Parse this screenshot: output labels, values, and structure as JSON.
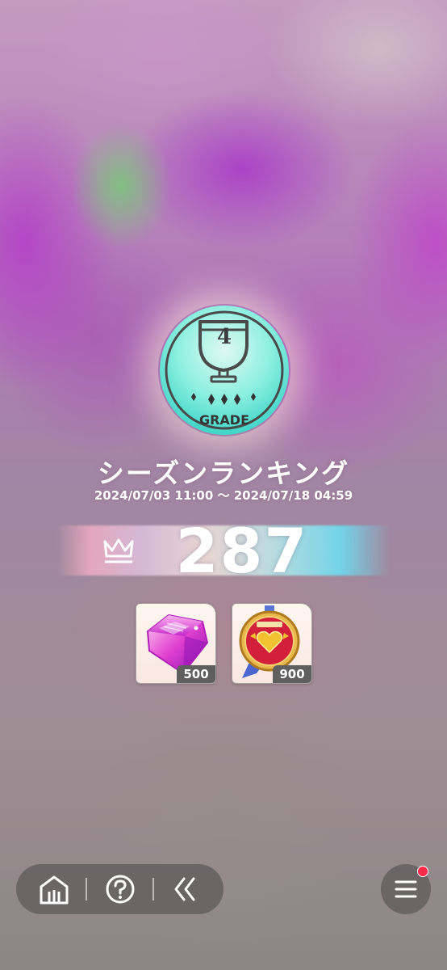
{
  "grade": {
    "number": "4",
    "label": "GRADE"
  },
  "season": {
    "title": "シーズンランキング",
    "period": "2024/07/03 11:00 ～ 2024/07/18 04:59"
  },
  "rank": {
    "value": "287",
    "icon": "crown-icon"
  },
  "rewards": [
    {
      "icon": "crystal-gem-icon",
      "count": "500"
    },
    {
      "icon": "medal-emblem-icon",
      "count": "900"
    }
  ],
  "nav": {
    "items": [
      {
        "icon": "home-icon"
      },
      {
        "icon": "help-icon"
      },
      {
        "icon": "back-icon"
      }
    ],
    "menu_icon": "menu-icon",
    "notification": true
  },
  "colors": {
    "badge_teal": "#5fe0d4",
    "notification_dot": "#ff2a4a",
    "badge_count_bg": "#5f5f5f"
  }
}
